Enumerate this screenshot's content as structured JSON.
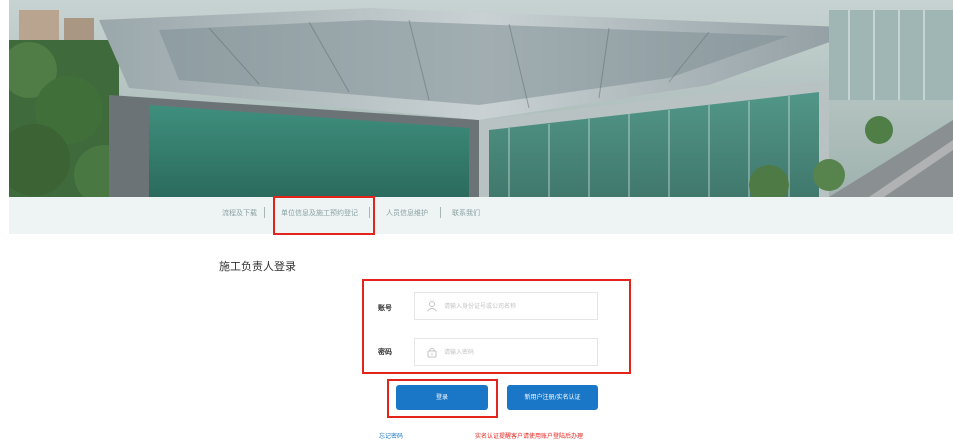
{
  "nav": {
    "items": [
      {
        "label": "流程及下载"
      },
      {
        "label": "单位信息及施工预约登记"
      },
      {
        "label": "人员信息维护"
      },
      {
        "label": "联系我们"
      }
    ]
  },
  "login": {
    "title": "施工负责人登录",
    "account_label": "账号",
    "account_placeholder": "请输入身份证号或公司名称",
    "password_label": "密码",
    "password_placeholder": "请输入密码",
    "login_button": "登录",
    "register_button": "新用户注册/实名认证",
    "forgot_link": "忘记密码",
    "notice": "实名认证提醒客户请使用账户登陆后办理"
  },
  "colors": {
    "primary": "#1a77c8",
    "highlight": "#e3241d",
    "nav_bg": "#eef4f4"
  }
}
